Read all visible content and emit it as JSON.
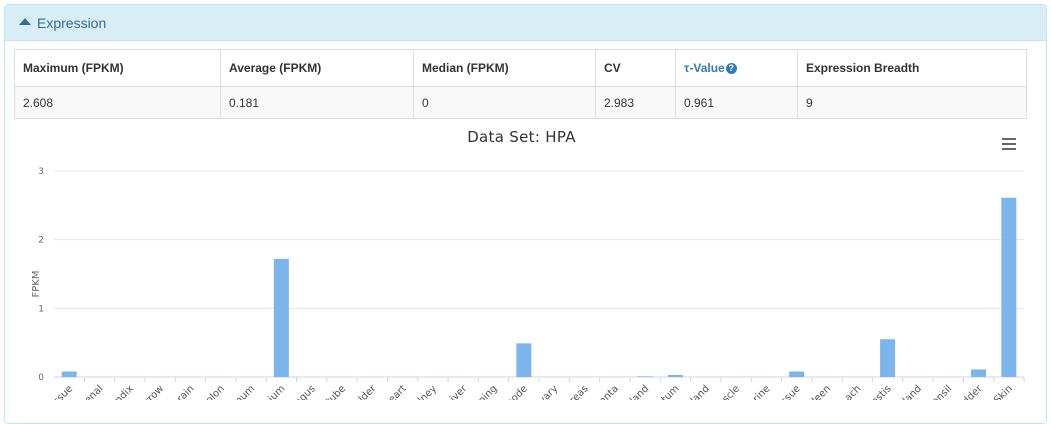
{
  "panel": {
    "title": "Expression"
  },
  "stats": {
    "headers": [
      "Maximum (FPKM)",
      "Average (FPKM)",
      "Median (FPKM)",
      "CV",
      "τ-Value",
      "Expression Breadth"
    ],
    "values": [
      "2.608",
      "0.181",
      "0",
      "2.983",
      "0.961",
      "9"
    ]
  },
  "chart_data": {
    "type": "bar",
    "title": "Data Set: HPA",
    "ylabel": "FPKM",
    "ylim": [
      0,
      3
    ],
    "yticks": [
      "0",
      "1",
      "2",
      "3"
    ],
    "grid": true,
    "bar_color": "#7cb5ec",
    "categories": [
      "ssue",
      "enal",
      "ndix",
      "rrow",
      "rain",
      "olon",
      "num",
      "ium",
      "agus",
      "tube",
      "lder",
      "eart",
      "dney",
      "iver",
      "ning",
      "node",
      "vary",
      "reas",
      "enta",
      "land",
      "atum",
      "land",
      "uscle",
      "rine",
      "ssue",
      "leen",
      "ach",
      "estis",
      "land",
      "onsil",
      "dder",
      "Skin"
    ],
    "values": [
      0.08,
      0,
      0,
      0,
      0,
      0,
      0,
      1.72,
      0,
      0,
      0,
      0,
      0,
      0,
      0,
      0.49,
      0,
      0,
      0,
      0.01,
      0.03,
      0,
      0,
      0,
      0.08,
      0,
      0,
      0.55,
      0,
      0,
      0.11,
      2.61
    ]
  }
}
